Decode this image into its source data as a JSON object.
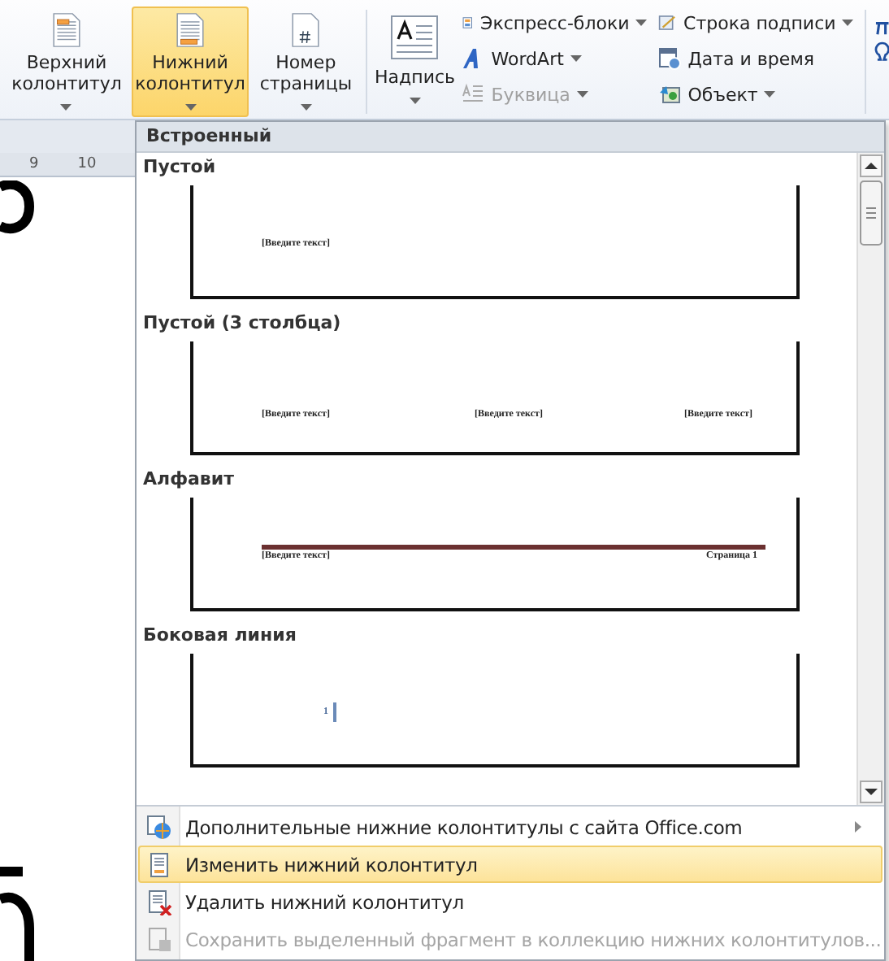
{
  "ribbon": {
    "large_buttons": [
      {
        "kind": "header",
        "label": "Верхний колонтитул",
        "selected": false
      },
      {
        "kind": "footer",
        "label": "Нижний колонтитул",
        "selected": true
      },
      {
        "kind": "page_number",
        "label": "Номер страницы",
        "selected": false
      },
      {
        "kind": "textbox",
        "label": "Надпись",
        "selected": false
      }
    ],
    "small_columns": [
      [
        {
          "kind": "quick_parts",
          "label": "Экспресс-блоки",
          "disabled": false,
          "dropdown": true
        },
        {
          "kind": "wordart",
          "label": "WordArt",
          "disabled": false,
          "dropdown": true
        },
        {
          "kind": "dropcap",
          "label": "Буквица",
          "disabled": true,
          "dropdown": true
        }
      ],
      [
        {
          "kind": "signature",
          "label": "Строка подписи",
          "disabled": false,
          "dropdown": true
        },
        {
          "kind": "datetime",
          "label": "Дата и время",
          "disabled": false,
          "dropdown": false
        },
        {
          "kind": "object",
          "label": "Объект",
          "disabled": false,
          "dropdown": true
        }
      ]
    ]
  },
  "ruler": {
    "marks": [
      "9",
      "10"
    ]
  },
  "dropdown": {
    "heading": "Встроенный",
    "gallery": [
      {
        "kind": "blank",
        "title": "Пустой",
        "texts": [
          "[Введите текст]"
        ]
      },
      {
        "kind": "three_columns",
        "title": "Пустой (3 столбца)",
        "texts": [
          "[Введите текст]",
          "[Введите текст]",
          "[Введите текст]"
        ]
      },
      {
        "kind": "alphabet",
        "title": "Алфавит",
        "texts": [
          "[Введите текст]",
          "Страница 1"
        ]
      },
      {
        "kind": "sideline",
        "title": "Боковая линия",
        "texts": [
          "1"
        ]
      }
    ],
    "menu": [
      {
        "kind": "more",
        "label": "Дополнительные нижние колонтитулы с сайта Office.com",
        "selected": false,
        "disabled": false,
        "submenu": true
      },
      {
        "kind": "edit",
        "label": "Изменить нижний колонтитул",
        "selected": true,
        "disabled": false,
        "submenu": false
      },
      {
        "kind": "remove",
        "label": "Удалить нижний колонтитул",
        "selected": false,
        "disabled": false,
        "submenu": false
      },
      {
        "kind": "save",
        "label": "Сохранить выделенный фрагмент в коллекцию нижних колонтитулов...",
        "selected": false,
        "disabled": true,
        "submenu": false
      }
    ]
  }
}
